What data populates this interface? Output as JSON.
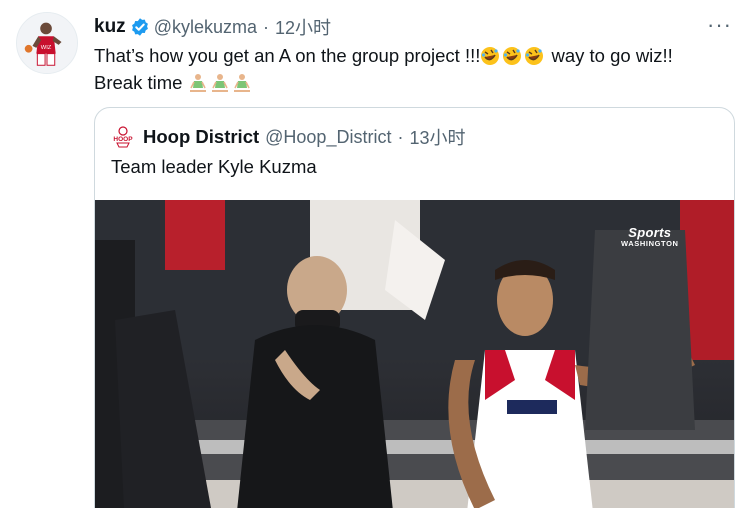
{
  "tweet": {
    "author": {
      "name": "kuz",
      "handle": "@kylekuzma",
      "time": "12小时"
    },
    "text_line1_a": "That’s how you get an A on the group project !!!",
    "text_line1_b": " way to go wiz!!",
    "text_line2": "Break time ",
    "laugh_emoji_count": 3,
    "meditate_emoji_count": 3
  },
  "quote": {
    "author": {
      "name": "Hoop District",
      "handle": "@Hoop_District",
      "time": "13小时"
    },
    "text": "Team leader Kyle Kuzma",
    "logo_text": "HOOP"
  },
  "media": {
    "watermark_brand": "Sports",
    "watermark_region": "WASHINGTON"
  },
  "colors": {
    "text": "#0f1419",
    "secondary": "#536471",
    "border": "#cfd9de",
    "verified": "#1d9bf0",
    "wizards_red": "#c8102e"
  },
  "separator": "·",
  "more_glyph": "···"
}
